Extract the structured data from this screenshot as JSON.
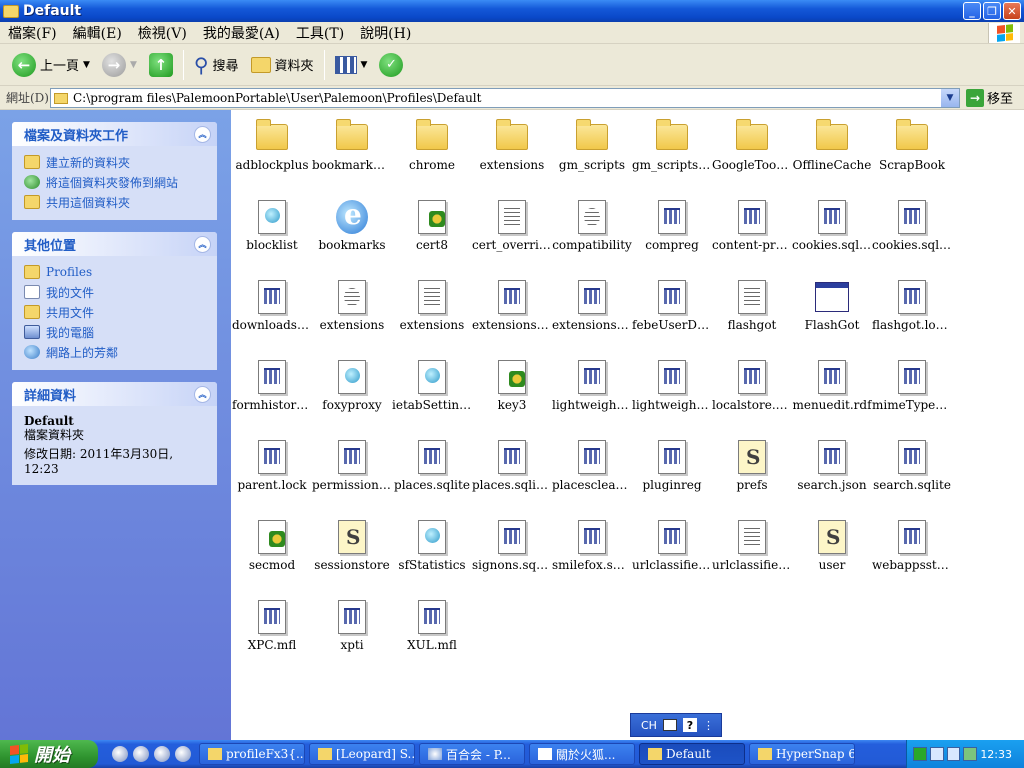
{
  "window": {
    "title": "Default"
  },
  "menu": [
    "檔案(F)",
    "編輯(E)",
    "檢視(V)",
    "我的最愛(A)",
    "工具(T)",
    "說明(H)"
  ],
  "toolbar": {
    "back_label": "上一頁",
    "search_label": "搜尋",
    "folders_label": "資料夾"
  },
  "address": {
    "label": "網址(D)",
    "path": "C:\\program files\\PalemoonPortable\\User\\Palemoon\\Profiles\\Default",
    "go_label": "移至"
  },
  "left": {
    "tasks": {
      "title": "檔案及資料夾工作",
      "items": [
        "建立新的資料夾",
        "將這個資料夾發佈到網站",
        "共用這個資料夾"
      ]
    },
    "places": {
      "title": "其他位置",
      "items": [
        "Profiles",
        "我的文件",
        "共用文件",
        "我的電腦",
        "網路上的芳鄰"
      ]
    },
    "details": {
      "title": "詳細資料",
      "name": "Default",
      "type": "檔案資料夾",
      "modified": "修改日期: 2011年3月30日, 12:23"
    }
  },
  "files": [
    {
      "name": "adblockplus",
      "icon": "folder"
    },
    {
      "name": "bookmarkba...",
      "icon": "folder"
    },
    {
      "name": "chrome",
      "icon": "folder"
    },
    {
      "name": "extensions",
      "icon": "folder"
    },
    {
      "name": "gm_scripts",
      "icon": "folder"
    },
    {
      "name": "gm_scripts_...",
      "icon": "folder"
    },
    {
      "name": "GoogleToolb...",
      "icon": "folder"
    },
    {
      "name": "OfflineCache",
      "icon": "folder"
    },
    {
      "name": "ScrapBook",
      "icon": "folder"
    },
    {
      "name": "blocklist",
      "icon": "web"
    },
    {
      "name": "bookmarks",
      "icon": "ie"
    },
    {
      "name": "cert8",
      "icon": "puzzle"
    },
    {
      "name": "cert_override",
      "icon": "text"
    },
    {
      "name": "compatibility",
      "icon": "gear"
    },
    {
      "name": "compreg",
      "icon": "data"
    },
    {
      "name": "content-prefs....",
      "icon": "data"
    },
    {
      "name": "cookies.sqlite",
      "icon": "data"
    },
    {
      "name": "cookies.sqlit...",
      "icon": "data"
    },
    {
      "name": "downloads.sq...",
      "icon": "data"
    },
    {
      "name": "extensions",
      "icon": "gear"
    },
    {
      "name": "extensions",
      "icon": "text"
    },
    {
      "name": "extensions.ca...",
      "icon": "data"
    },
    {
      "name": "extensions.rdf",
      "icon": "data"
    },
    {
      "name": "febeUserDefi...",
      "icon": "data"
    },
    {
      "name": "flashgot",
      "icon": "text"
    },
    {
      "name": "FlashGot",
      "icon": "window"
    },
    {
      "name": "flashgot.log.bak",
      "icon": "data"
    },
    {
      "name": "formhistory.s...",
      "icon": "data"
    },
    {
      "name": "foxyproxy",
      "icon": "web"
    },
    {
      "name": "ietabSettings",
      "icon": "web"
    },
    {
      "name": "key3",
      "icon": "puzzle"
    },
    {
      "name": "lightweightt...",
      "icon": "data"
    },
    {
      "name": "lightweight...",
      "icon": "data"
    },
    {
      "name": "localstore.rdf",
      "icon": "data"
    },
    {
      "name": "menuedit.rdf",
      "icon": "data"
    },
    {
      "name": "mimeTypes.rdf",
      "icon": "data"
    },
    {
      "name": "parent.lock",
      "icon": "data"
    },
    {
      "name": "permissions.s...",
      "icon": "data"
    },
    {
      "name": "places.sqlite",
      "icon": "data"
    },
    {
      "name": "places.sqlite-j...",
      "icon": "data"
    },
    {
      "name": "placescleaner...",
      "icon": "data"
    },
    {
      "name": "pluginreg",
      "icon": "data"
    },
    {
      "name": "prefs",
      "icon": "script"
    },
    {
      "name": "search.json",
      "icon": "data"
    },
    {
      "name": "search.sqlite",
      "icon": "data"
    },
    {
      "name": "secmod",
      "icon": "puzzle"
    },
    {
      "name": "sessionstore",
      "icon": "script"
    },
    {
      "name": "sfStatistics",
      "icon": "web"
    },
    {
      "name": "signons.sqlite",
      "icon": "data"
    },
    {
      "name": "smilefox.sqlite",
      "icon": "data"
    },
    {
      "name": "urlclassifier3....",
      "icon": "data"
    },
    {
      "name": "urlclassifierk...",
      "icon": "text"
    },
    {
      "name": "user",
      "icon": "script"
    },
    {
      "name": "webappsstor...",
      "icon": "data"
    },
    {
      "name": "XPC.mfl",
      "icon": "data"
    },
    {
      "name": "xpti",
      "icon": "data"
    },
    {
      "name": "XUL.mfl",
      "icon": "data"
    }
  ],
  "langbar": {
    "lang": "CH"
  },
  "taskbar": {
    "start_label": "開始",
    "tasks": [
      "profileFx3{...",
      "[Leopard] S...",
      "百合会 - P...",
      "關於火狐...",
      "Default",
      "HyperSnap 6"
    ],
    "active_task": 4,
    "time": "12:33"
  },
  "colors": {
    "title_blue": "#0a48c8",
    "panel_link": "#215dc6",
    "taskbar_blue": "#245edc",
    "start_green": "#2f942f"
  }
}
